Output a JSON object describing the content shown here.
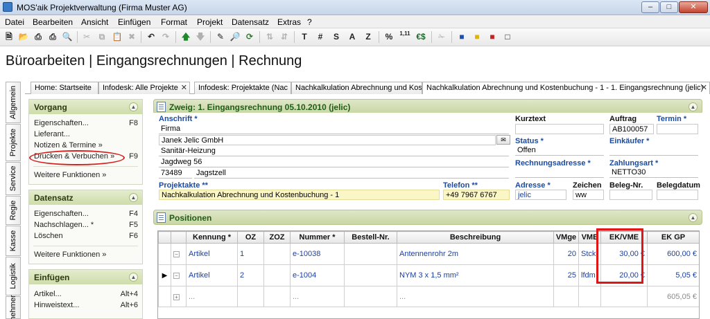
{
  "window": {
    "title": "MOS'aik Projektverwaltung (Firma Muster AG)",
    "minimize": "–",
    "maximize": "□",
    "close": "✕"
  },
  "menu": [
    "Datei",
    "Bearbeiten",
    "Ansicht",
    "Einfügen",
    "Format",
    "Projekt",
    "Datensatz",
    "Extras",
    "?"
  ],
  "toolbar": {
    "buttons": [
      "new-doc-icon",
      "open-folder-icon",
      "print-icon",
      "print-preview-icon",
      "cut-icon",
      "copy-icon",
      "paste-icon",
      "delete-icon",
      "undo-icon",
      "redo-icon",
      "arrow-up-icon",
      "arrow-down-icon",
      "pencil-icon",
      "find-icon",
      "refresh-icon",
      "sort-icon",
      "sort-desc-icon"
    ],
    "text_buttons": [
      "T",
      "#",
      "S",
      "A",
      "Z",
      "%",
      "1,11",
      "€$"
    ],
    "user_icons": [
      "user-blue-icon",
      "user-yellow-icon",
      "user-red-icon",
      "window-icon"
    ]
  },
  "page_title": "Büroarbeiten | Eingangsrechnungen | Rechnung",
  "tabs": [
    {
      "label": "Home: Startseite",
      "closable": false
    },
    {
      "label": "Infodesk: Alle Projekte",
      "closable": true
    },
    {
      "label": "Infodesk: Projektakte (Nac",
      "closable": false
    },
    {
      "label": "Nachkalkulation Abrechnung und Kost",
      "closable": false
    },
    {
      "label": "Nachkalkulation Abrechnung und Kostenbuchung - 1 - 1. Eingangsrechnung (jelic)",
      "closable": true,
      "active": true
    }
  ],
  "vertical_tabs": [
    "Allgemein",
    "Projekte",
    "Service",
    "Regie",
    "Kasse",
    "Logistik",
    "nehmer"
  ],
  "taskpane": {
    "vorgang": {
      "title": "Vorgang",
      "items": [
        {
          "label": "Eigenschaften...",
          "key": "F8"
        },
        {
          "label": "Lieferant...",
          "key": ""
        },
        {
          "label": "Notizen & Termine »",
          "key": ""
        },
        {
          "label": "Drucken & Verbuchen »",
          "key": "F9"
        }
      ],
      "more": "Weitere Funktionen »"
    },
    "datensatz": {
      "title": "Datensatz",
      "items": [
        {
          "label": "Eigenschaften...",
          "key": "F4"
        },
        {
          "label": "Nachschlagen... *",
          "key": "F5"
        },
        {
          "label": "Löschen",
          "key": "F6"
        }
      ],
      "more": "Weitere Funktionen »"
    },
    "einfuegen": {
      "title": "Einfügen",
      "items": [
        {
          "label": "Artikel...",
          "key": "Alt+4"
        },
        {
          "label": "Hinweistext...",
          "key": "Alt+6"
        }
      ]
    }
  },
  "header_section": {
    "title": "Zweig: 1. Eingangsrechnung 05.10.2010 (jelic)",
    "anschrift_label": "Anschrift *",
    "anschrift": [
      "Firma",
      "Janek Jelic GmbH",
      "Sanitär-Heizung",
      "Jagdweg 56"
    ],
    "plz": "73489",
    "ort": "Jagstzell",
    "kurztext_label": "Kurztext",
    "kurztext": "",
    "auftrag_label": "Auftrag",
    "auftrag": "AB100057",
    "termin_label": "Termin *",
    "termin": "",
    "status_label": "Status *",
    "status": "Offen",
    "einkaeufer_label": "Einkäufer *",
    "einkaeufer": "",
    "rechnungsadresse_label": "Rechnungsadresse *",
    "rechnungsadresse": "",
    "zahlungsart_label": "Zahlungsart *",
    "zahlungsart": "NETTO30",
    "projektakte_label": "Projektakte **",
    "projektakte": "Nachkalkulation Abrechnung und Kostenbuchung - 1",
    "telefon_label": "Telefon **",
    "telefon": "+49 7967 6767",
    "adresse_label": "Adresse *",
    "adresse": "jelic",
    "zeichen_label": "Zeichen",
    "zeichen": "ww",
    "belegnr_label": "Beleg-Nr.",
    "belegnr": "",
    "belegdatum_label": "Belegdatum",
    "belegdatum": "",
    "lookup_button": "✉"
  },
  "positions": {
    "title": "Positionen",
    "columns": [
      "Kennung *",
      "OZ",
      "ZOZ",
      "Nummer *",
      "Bestell-Nr.",
      "Beschreibung",
      "VMge",
      "VME",
      "EK/VME",
      "EK GP"
    ],
    "rows": [
      {
        "marker": "",
        "kennung": "Artikel",
        "oz": "1",
        "zoz": "",
        "nummer": "e-10038",
        "bestell": "",
        "beschreibung": "Antennenrohr 2m",
        "vmge": "20",
        "vme": "Stck",
        "ek_vme": "30,00 €",
        "ek_gp": "600,00 €"
      },
      {
        "marker": "▶",
        "kennung": "Artikel",
        "oz": "2",
        "zoz": "",
        "nummer": "e-1004",
        "bestell": "",
        "beschreibung": "NYM 3 x 1,5 mm²",
        "vmge": "25",
        "vme": "lfdm",
        "ek_vme": "20,00 €",
        "ek_gp": "5,05 €"
      },
      {
        "marker": "",
        "kennung": "...",
        "oz": "",
        "zoz": "",
        "nummer": "...",
        "bestell": "",
        "beschreibung": "...",
        "vmge": "",
        "vme": "",
        "ek_vme": "",
        "ek_gp": "605,05 €"
      }
    ]
  },
  "colors": {
    "accent_green": "#1d5d16",
    "label_blue": "#1b4aa0",
    "highlight_red": "#e01616"
  }
}
